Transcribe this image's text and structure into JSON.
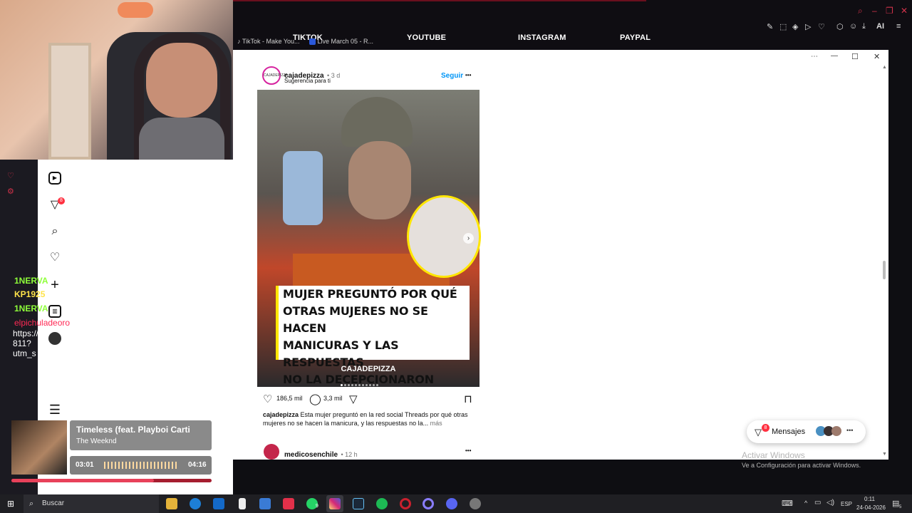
{
  "browser": {
    "nav_links": [
      "TIKTOK",
      "YOUTUBE",
      "INSTAGRAM",
      "PAYPAL"
    ],
    "tabs": [
      "TikTok - Make You...",
      "Live March 05 - R..."
    ],
    "window_controls": [
      "minimize",
      "maximize",
      "close"
    ]
  },
  "instagram_sidebar": {
    "icons": [
      "reels-icon",
      "messages-icon",
      "search-icon",
      "heart-icon",
      "create-icon",
      "dashboard-icon",
      "avatar",
      "menu-icon"
    ],
    "messages_badge": "8"
  },
  "chat": [
    {
      "user": "1NERVA",
      "text": "",
      "color": "#8fff3a"
    },
    {
      "user": "KP1925",
      "text": "",
      "color": "#ffe34a"
    },
    {
      "user": "1NERVA",
      "text": "",
      "color": "#8fff3a"
    },
    {
      "user": "elpichuladeoro",
      "text": "",
      "color": "#ff2a55"
    },
    {
      "user": "",
      "text": "https://",
      "color": "#ffffff"
    },
    {
      "user": "",
      "text": "811?",
      "color": "#ffffff"
    },
    {
      "user": "",
      "text": "utm_s",
      "color": "#ffffff"
    }
  ],
  "post": {
    "username": "cajadepizza",
    "avatar_text": "CAJADEPIZZA",
    "age": "• 3 d",
    "suggestion": "Sugerencia para ti",
    "follow": "Seguir",
    "more": "•••",
    "headline": [
      "MUJER PREGUNTÓ POR QUÉ",
      "OTRAS MUJERES NO SE HACEN",
      "MANICURAS Y LAS RESPUESTAS",
      "NO LA DECEPCIONARON"
    ],
    "brand_tag": "CAJADEPIZZA",
    "likes": "186,5 mil",
    "comments": "3,3 mil",
    "caption_user": "cajadepizza",
    "caption_text": "Esta mujer preguntó en la red social Threads por qué otras mujeres no se hacen la manicura, y las respuestas no la...",
    "caption_more": "más"
  },
  "next_post": {
    "username": "medicosenchile",
    "age": "• 12 h",
    "more": "•••"
  },
  "messages": {
    "label": "Mensajes",
    "badge": "8"
  },
  "activation": {
    "title": "Activar Windows",
    "subtitle": "Ve a Configuración para activar Windows."
  },
  "music": {
    "title": "Timeless (feat. Playboi Carti",
    "artist": "The Weeknd",
    "elapsed": "03:01",
    "total": "04:16",
    "progress_fraction": 0.71
  },
  "taskbar": {
    "search_placeholder": "Buscar",
    "language": "ESP",
    "time": "0:11",
    "date": "24-04-2026",
    "whatsapp_badge": "9",
    "notif_count": "5"
  }
}
